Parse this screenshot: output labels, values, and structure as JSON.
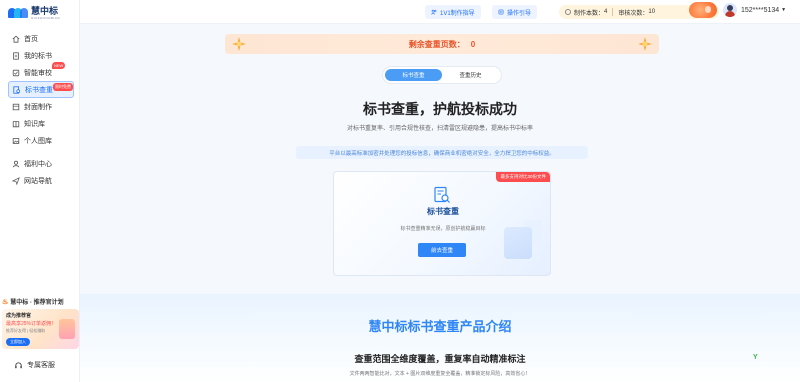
{
  "brand": {
    "name": "慧中标",
    "tagline": "HUIZHONGBIAO"
  },
  "sidebar": {
    "items": [
      {
        "label": "首页",
        "icon": "home-icon"
      },
      {
        "label": "我的标书",
        "icon": "file-icon"
      },
      {
        "label": "智能审校",
        "icon": "review-icon",
        "badge": "NEW"
      },
      {
        "label": "标书查重",
        "icon": "search-doc-icon",
        "badge": "限时免费",
        "active": true
      },
      {
        "label": "封面制作",
        "icon": "cover-icon"
      },
      {
        "label": "知识库",
        "icon": "book-icon"
      },
      {
        "label": "个人图库",
        "icon": "image-icon"
      },
      {
        "label": "福利中心",
        "icon": "user-icon"
      },
      {
        "label": "网站导航",
        "icon": "send-icon"
      }
    ],
    "promo": {
      "title": "慧中标 · 推荐官计划",
      "line1": "成为推荐官",
      "line2": "最高享25%订单返佣！",
      "line3": "推荐好友得 | 轻松赚取",
      "button": "立即加入"
    },
    "service": "专属客服"
  },
  "topbar": {
    "guide": "1V1制作指导",
    "operation": "操作引导",
    "counts": {
      "make_label": "制作本数：",
      "make_value": "4",
      "review_label": "审核次数：",
      "review_value": "10"
    },
    "user": "152****5134"
  },
  "main": {
    "remain_label": "剩余查重页数：",
    "remain_value": "0",
    "tabs": [
      {
        "label": "标书查重",
        "active": true
      },
      {
        "label": "查重历史",
        "active": false
      }
    ],
    "hero_title": "标书查重，护航投标成功",
    "hero_sub": "对标书重复率、引用合规性核查，扫清雷区规避隐患，提高标书中标率",
    "notice": "平台以最高标准加密并处理您的投标信息，确保商业机密绝对安全，全力捍卫您的中标权益。",
    "card": {
      "ribbon": "最多支持对比30份文件",
      "title": "标书查重",
      "desc": "标书查重精准无误，原创护航稳赢目标",
      "button": "前去查重"
    },
    "intro": {
      "title": "慧中标标书查重产品介绍",
      "subtitle": "查重范围全维度覆盖，重复率自动精准标注",
      "desc": "文件两两智能比对，文本 + 图片双维度重复全覆盖，精准锁定标风险，高效省心！"
    }
  },
  "colors": {
    "accent": "#1c6ff5",
    "warn": "#e8542a",
    "badge": "#ff4d4f"
  }
}
